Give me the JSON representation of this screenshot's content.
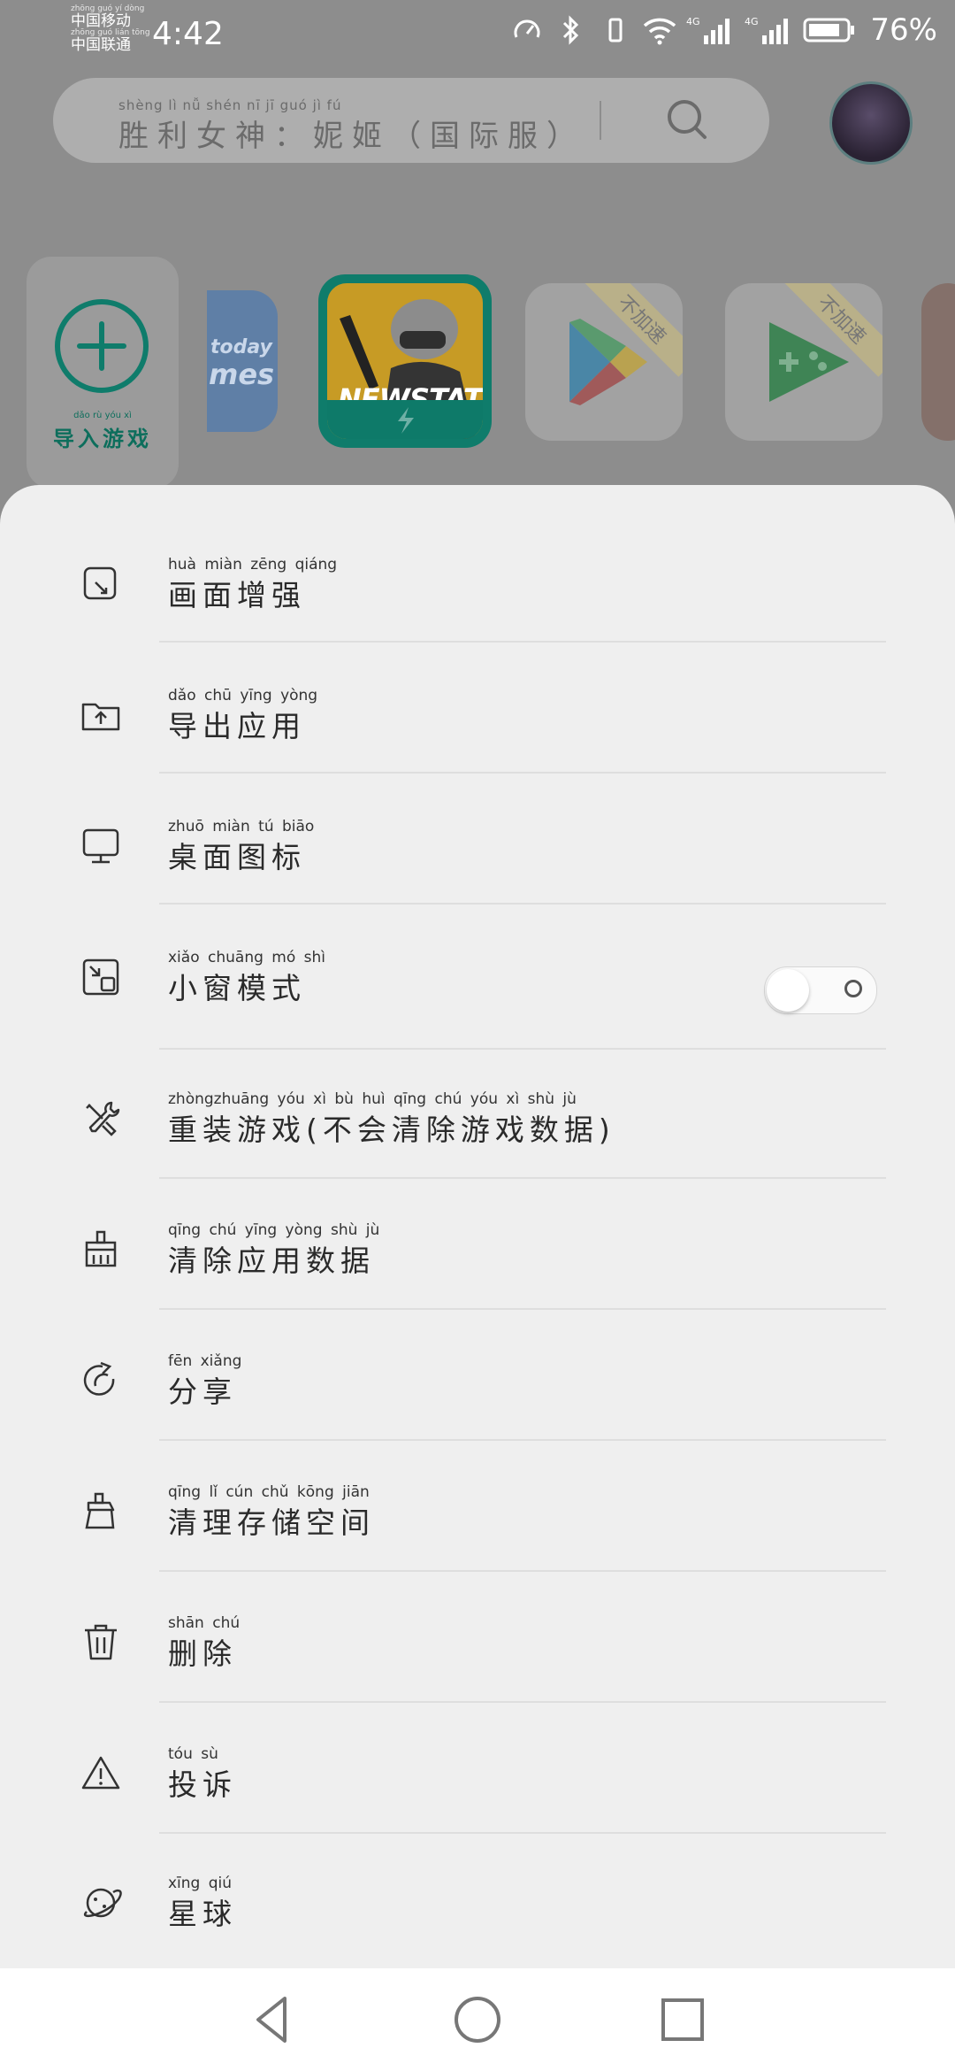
{
  "status_bar": {
    "carrier1_pinyin": "zhōng guó  yí  dòng",
    "carrier1": "中国移动",
    "carrier2_pinyin": "zhōng guó  lián  tōng",
    "carrier2": "中国联通",
    "time": "4:42",
    "network1": "4G",
    "network2": "4G",
    "battery": "76%"
  },
  "search": {
    "pinyin": "shèng  lì   nǚ  shén      nī   jī      guó   jì   fú",
    "text": "胜利女神：妮姬（国际服）",
    "icon": "search-icon"
  },
  "games": {
    "import_pinyin": "dǎo  rù  yóu  xì",
    "import_label": "导入游戏",
    "today_text": "today\nmes",
    "newstate_title": "NEWSTATE",
    "ribbon1": "不加速",
    "ribbon2": "不加速"
  },
  "menu": [
    {
      "icon": "image-enhance-icon",
      "pinyin": "huà  miàn zēng qiáng",
      "label": "画面增强"
    },
    {
      "icon": "export-folder-icon",
      "pinyin": "dǎo   chū  yīng  yòng",
      "label": "导出应用"
    },
    {
      "icon": "monitor-icon",
      "pinyin": "zhuō miàn   tú   biāo",
      "label": "桌面图标"
    },
    {
      "icon": "small-window-icon",
      "pinyin": "xiǎo chuāng  mó   shì",
      "label": "小窗模式",
      "toggle": false
    },
    {
      "icon": "tools-icon",
      "pinyin": "zhòngzhuāng yóu   xì     bù   huì  qīng  chú  yóu   xì   shù   jù",
      "label": "重装游戏(不会清除游戏数据)"
    },
    {
      "icon": "clear-data-icon",
      "pinyin": "qīng  chú  yīng yòng  shù   jù",
      "label": "清除应用数据"
    },
    {
      "icon": "share-icon",
      "pinyin": "fēn  xiǎng",
      "label": "分享"
    },
    {
      "icon": "clean-storage-icon",
      "pinyin": "qīng   lǐ    cún   chǔ  kōng  jiān",
      "label": "清理存储空间"
    },
    {
      "icon": "trash-icon",
      "pinyin": "shān  chú",
      "label": "删除"
    },
    {
      "icon": "warning-icon",
      "pinyin": "tóu   sù",
      "label": "投诉"
    },
    {
      "icon": "planet-icon",
      "pinyin": "xīng  qiú",
      "label": "星球"
    }
  ],
  "colors": {
    "accent": "#0f7c6b",
    "sheet_bg": "#efefef",
    "dim_bg": "#8d8d8d"
  }
}
